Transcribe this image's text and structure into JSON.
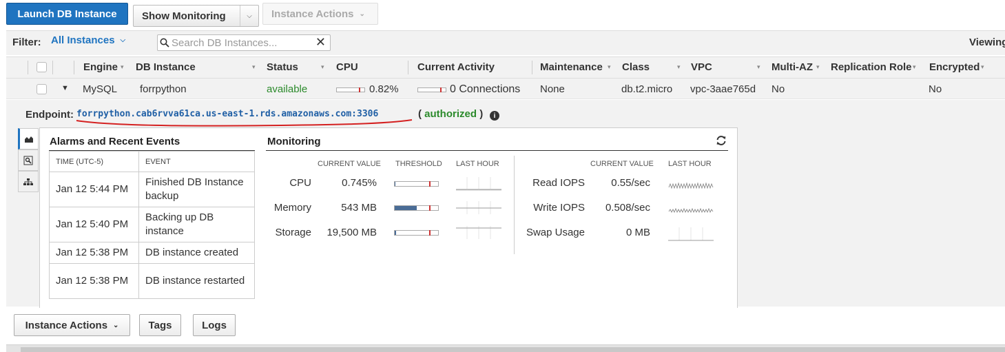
{
  "toolbar": {
    "launch_label": "Launch DB Instance",
    "show_monitoring_label": "Show Monitoring",
    "instance_actions_label": "Instance Actions"
  },
  "filter": {
    "label": "Filter:",
    "selected": "All Instances",
    "search_placeholder": "Search DB Instances...",
    "viewing_label": "Viewing"
  },
  "columns": [
    "Engine",
    "DB Instance",
    "Status",
    "CPU",
    "Current Activity",
    "Maintenance",
    "Class",
    "VPC",
    "Multi-AZ",
    "Replication Role",
    "Encrypted"
  ],
  "instance": {
    "engine": "MySQL",
    "db_instance": "forrpython",
    "status": "available",
    "cpu": "0.82%",
    "cpu_fraction": 0.0082,
    "current_activity": "0 Connections",
    "maintenance": "None",
    "class": "db.t2.micro",
    "vpc": "vpc-3aae765d",
    "multi_az": "No",
    "replication_role": "",
    "encrypted": "No"
  },
  "detail": {
    "endpoint_label": "Endpoint:",
    "endpoint": "forrpython.cab6rvva61ca.us-east-1.rds.amazonaws.com:3306",
    "auth_open": "(",
    "auth_status": "authorized",
    "auth_close": ")"
  },
  "alarms": {
    "title": "Alarms and Recent Events",
    "time_header": "TIME (UTC-5)",
    "event_header": "EVENT",
    "events": [
      {
        "time": "Jan 12 5:44 PM",
        "event": "Finished DB Instance backup"
      },
      {
        "time": "Jan 12 5:40 PM",
        "event": "Backing up DB instance"
      },
      {
        "time": "Jan 12 5:38 PM",
        "event": "DB instance created"
      },
      {
        "time": "Jan 12 5:38 PM",
        "event": "DB instance restarted"
      }
    ]
  },
  "monitoring": {
    "title": "Monitoring",
    "headers": {
      "current_value": "CURRENT VALUE",
      "threshold": "THRESHOLD",
      "last_hour": "LAST HOUR"
    },
    "left": [
      {
        "label": "CPU",
        "value": "0.745%",
        "fill": 0.01
      },
      {
        "label": "Memory",
        "value": "543 MB",
        "fill": 0.5
      },
      {
        "label": "Storage",
        "value": "19,500 MB",
        "fill": 0.03
      }
    ],
    "right": [
      {
        "label": "Read IOPS",
        "value": "0.55/sec"
      },
      {
        "label": "Write IOPS",
        "value": "0.508/sec"
      },
      {
        "label": "Swap Usage",
        "value": "0 MB"
      }
    ]
  },
  "bottom": {
    "instance_actions_label": "Instance Actions",
    "tags_label": "Tags",
    "logs_label": "Logs"
  },
  "colors": {
    "primary": "#1f74c0",
    "status_green": "#2b8a2b",
    "link": "#1f5fa5",
    "annotation_red": "#d42020"
  }
}
